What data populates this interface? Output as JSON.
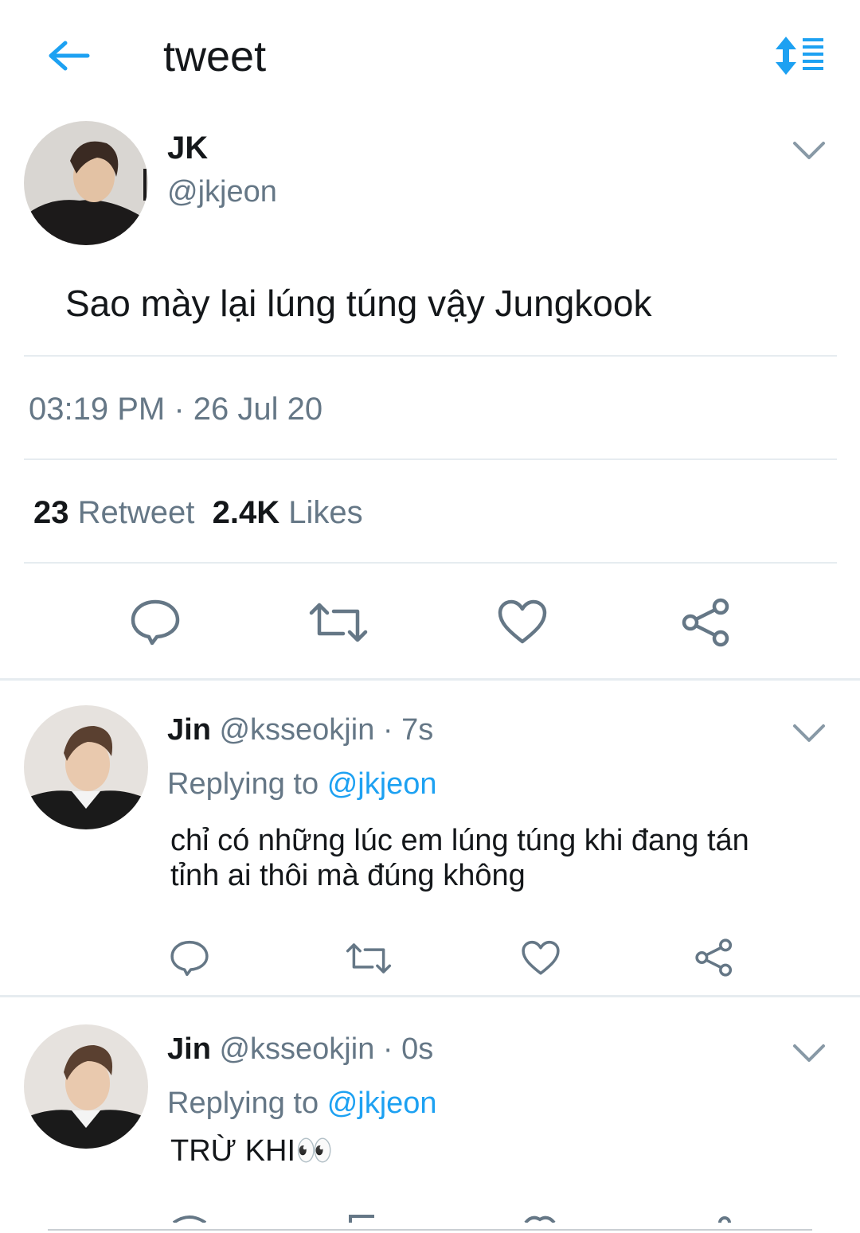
{
  "header": {
    "title": "tweet",
    "back_icon": "arrow-left-icon",
    "sort_icon": "sort-list-icon",
    "accent": "#1da1f2"
  },
  "tweet": {
    "author_name": "JK",
    "author_handle": "@jkjeon",
    "text": "Sao mày lại lúng túng vậy Jungkook",
    "timestamp": "03:19 PM · 26 Jul 20",
    "retweet_count": "23",
    "retweet_label": "Retweet",
    "likes_count": "2.4K",
    "likes_label": "Likes"
  },
  "replies": [
    {
      "name": "Jin",
      "handle_time": "@ksseokjin · 7s",
      "replying_label": "Replying to",
      "mention": "@jkjeon",
      "text": "chỉ có những lúc em lúng túng khi đang tán tỉnh ai thôi mà đúng không"
    },
    {
      "name": "Jin",
      "handle_time": "@ksseokjin · 0s",
      "replying_label": "Replying to",
      "mention": "@jkjeon",
      "text": "TRỪ KHI👀"
    }
  ],
  "colors": {
    "text": "#14171a",
    "secondary": "#657786",
    "divider": "#e6ecf0",
    "icon": "#657786"
  }
}
